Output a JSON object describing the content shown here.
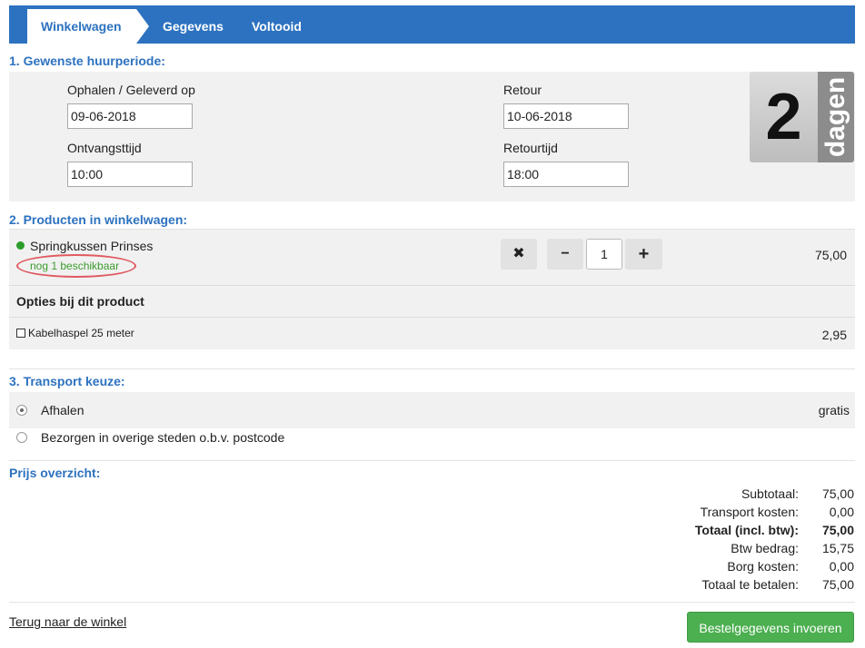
{
  "steps": {
    "cart": "Winkelwagen",
    "details": "Gegevens",
    "done": "Voltooid"
  },
  "period": {
    "title": "1. Gewenste huurperiode:",
    "pickup_label": "Ophalen / Geleverd op",
    "pickup_date": "09-06-2018",
    "return_label": "Retour",
    "return_date": "10-06-2018",
    "receive_time_label": "Ontvangsttijd",
    "receive_time": "10:00",
    "return_time_label": "Retourtijd",
    "return_time": "18:00",
    "days_number": "2",
    "days_word": "dagen"
  },
  "products": {
    "title": "2. Producten in winkelwagen:",
    "item_name": "Springkussen Prinses",
    "availability": "nog 1 beschikbaar",
    "remove_symbol": "✖",
    "minus_symbol": "−",
    "plus_symbol": "+",
    "quantity": "1",
    "price": "75,00",
    "options_title": "Opties bij dit product",
    "option_name": "Kabelhaspel 25 meter",
    "option_price": "2,95"
  },
  "transport": {
    "title": "3. Transport keuze:",
    "option1": "Afhalen",
    "option1_price": "gratis",
    "option2": "Bezorgen in overige steden o.b.v. postcode"
  },
  "prices": {
    "title": "Prijs overzicht:",
    "rows": [
      {
        "label": "Subtotaal:",
        "value": "75,00"
      },
      {
        "label": "Transport kosten:",
        "value": "0,00"
      },
      {
        "label": "Totaal (incl. btw):",
        "value": "75,00"
      },
      {
        "label": "Btw bedrag:",
        "value": "15,75"
      },
      {
        "label": "Borg kosten:",
        "value": "0,00"
      },
      {
        "label": "Totaal te betalen:",
        "value": "75,00"
      }
    ]
  },
  "footer": {
    "back_link": "Terug naar de winkel",
    "submit": "Bestelgegevens invoeren"
  },
  "colors": {
    "brand_blue": "#2d72c0",
    "green_button": "#4caf50",
    "available_green": "#3c9b2e"
  }
}
